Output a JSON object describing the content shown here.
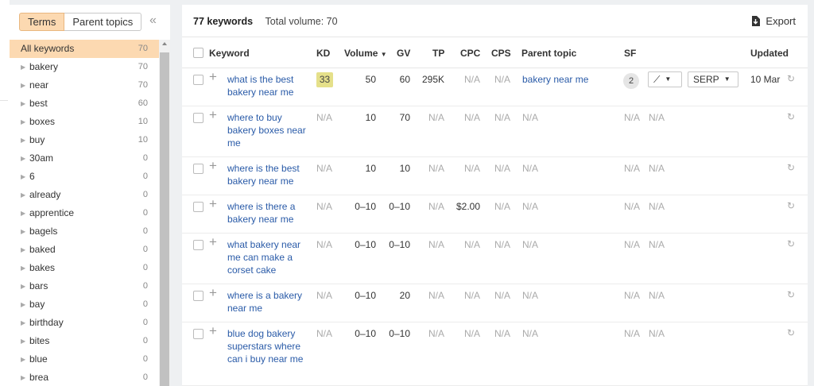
{
  "sidebar": {
    "tabs": [
      {
        "label": "Terms"
      },
      {
        "label": "Parent topics"
      }
    ],
    "collapse_glyph": "«",
    "terms": [
      {
        "name": "All keywords",
        "count": "70",
        "active": true
      },
      {
        "name": "bakery",
        "count": "70"
      },
      {
        "name": "near",
        "count": "70"
      },
      {
        "name": "best",
        "count": "60"
      },
      {
        "name": "boxes",
        "count": "10"
      },
      {
        "name": "buy",
        "count": "10"
      },
      {
        "name": "30am",
        "count": "0"
      },
      {
        "name": "6",
        "count": "0"
      },
      {
        "name": "already",
        "count": "0"
      },
      {
        "name": "apprentice",
        "count": "0"
      },
      {
        "name": "bagels",
        "count": "0"
      },
      {
        "name": "baked",
        "count": "0"
      },
      {
        "name": "bakes",
        "count": "0"
      },
      {
        "name": "bars",
        "count": "0"
      },
      {
        "name": "bay",
        "count": "0"
      },
      {
        "name": "birthday",
        "count": "0"
      },
      {
        "name": "bites",
        "count": "0"
      },
      {
        "name": "blue",
        "count": "0"
      },
      {
        "name": "brea",
        "count": "0"
      }
    ]
  },
  "summary": {
    "keywords": "77 keywords",
    "total_volume": "Total volume: 70"
  },
  "export_label": "Export",
  "columns": {
    "keyword": "Keyword",
    "kd": "KD",
    "volume": "Volume",
    "volume_sort": "▼",
    "gv": "GV",
    "tp": "TP",
    "cpc": "CPC",
    "cps": "CPS",
    "parent_topic": "Parent topic",
    "sf": "SF",
    "updated": "Updated"
  },
  "rows": [
    {
      "keyword": "what is the best bakery near me",
      "kd": "33",
      "volume": "50",
      "gv": "60",
      "tp": "295K",
      "cpc": "N/A",
      "cps": "N/A",
      "parent_topic": "bakery near me",
      "sf": "2",
      "trend_glyph": "⟋",
      "serp_label": "SERP",
      "updated": "10 Mar"
    },
    {
      "keyword": "where to buy bakery boxes near me",
      "kd": "N/A",
      "volume": "10",
      "gv": "70",
      "tp": "N/A",
      "cpc": "N/A",
      "cps": "N/A",
      "parent_topic": "N/A",
      "sf": "N/A",
      "extra": "N/A"
    },
    {
      "keyword": "where is the best bakery near me",
      "kd": "N/A",
      "volume": "10",
      "gv": "10",
      "tp": "N/A",
      "cpc": "N/A",
      "cps": "N/A",
      "parent_topic": "N/A",
      "sf": "N/A",
      "extra": "N/A"
    },
    {
      "keyword": "where is there a bakery near me",
      "kd": "N/A",
      "volume": "0–10",
      "gv": "0–10",
      "tp": "N/A",
      "cpc": "$2.00",
      "cps": "N/A",
      "parent_topic": "N/A",
      "sf": "N/A",
      "extra": "N/A"
    },
    {
      "keyword": "what bakery near me can make a corset cake",
      "kd": "N/A",
      "volume": "0–10",
      "gv": "0–10",
      "tp": "N/A",
      "cpc": "N/A",
      "cps": "N/A",
      "parent_topic": "N/A",
      "sf": "N/A",
      "extra": "N/A"
    },
    {
      "keyword": "where is a bakery near me",
      "kd": "N/A",
      "volume": "0–10",
      "gv": "20",
      "tp": "N/A",
      "cpc": "N/A",
      "cps": "N/A",
      "parent_topic": "N/A",
      "sf": "N/A",
      "extra": "N/A"
    },
    {
      "keyword": "blue dog bakery superstars where can i buy near me",
      "kd": "N/A",
      "volume": "0–10",
      "gv": "0–10",
      "tp": "N/A",
      "cpc": "N/A",
      "cps": "N/A",
      "parent_topic": "N/A",
      "sf": "N/A",
      "extra": "N/A"
    }
  ]
}
